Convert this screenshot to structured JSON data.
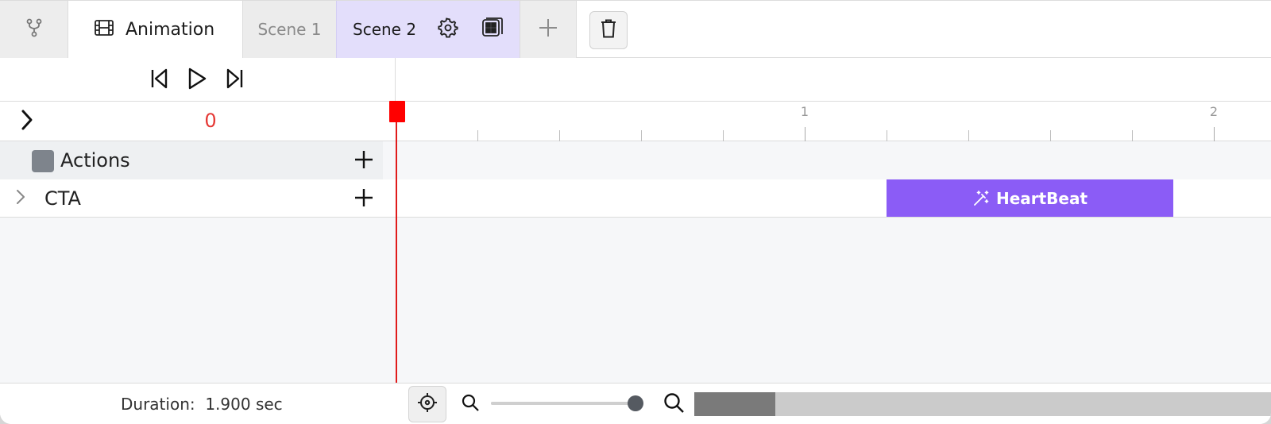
{
  "tabs": {
    "branch_icon": "branch-icon",
    "animation": {
      "label": "Animation",
      "icon": "film-icon"
    },
    "scene1": {
      "label": "Scene 1"
    },
    "scene2": {
      "label": "Scene 2",
      "icons": [
        "gear-icon",
        "layout-grid-icon"
      ]
    },
    "add_icon": "plus-icon",
    "trash_icon": "trash-icon"
  },
  "transport": {
    "icons": [
      "skip-back-icon",
      "play-icon",
      "skip-forward-icon"
    ]
  },
  "timeline": {
    "current_frame": "0",
    "ruler_labels": [
      "1",
      "2"
    ],
    "ruler_range_seconds": [
      0,
      2.1
    ],
    "playhead_seconds": 0
  },
  "tracks": [
    {
      "label": "Actions",
      "type": "group",
      "swatch_color": "#7e848c"
    },
    {
      "label": "CTA",
      "type": "element",
      "clips": [
        {
          "label": "HeartBeat",
          "icon": "magic-wand-icon",
          "start": 1.2,
          "end": 1.9,
          "color": "#8b5cf6"
        }
      ]
    }
  ],
  "footer": {
    "duration_label": "Duration:",
    "duration_value": "1.900 sec",
    "zoom_level": 0.96,
    "scroll_fraction": 0.14
  },
  "colors": {
    "accent": "#8b5cf6",
    "playhead": "#ff0000",
    "active_tab": "#e3defb"
  }
}
